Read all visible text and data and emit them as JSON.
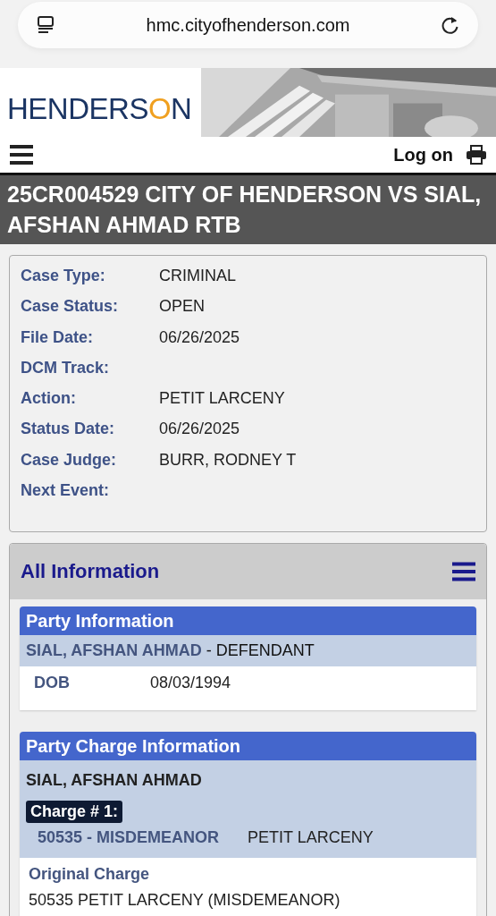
{
  "browser": {
    "url": "hmc.cityofhenderson.com"
  },
  "header": {
    "logo": "HENDERSON"
  },
  "nav": {
    "login": "Log on"
  },
  "case_title": "25CR004529 CITY OF HENDERSON VS SIAL, AFSHAN AHMAD RTB",
  "case_info": [
    {
      "label": "Case Type:",
      "value": "CRIMINAL"
    },
    {
      "label": "Case Status:",
      "value": "OPEN"
    },
    {
      "label": "File Date:",
      "value": "06/26/2025"
    },
    {
      "label": "DCM Track:"
    },
    {
      "label": "Action:",
      "value": "PETIT LARCENY"
    },
    {
      "label": "Status Date:",
      "value": "06/26/2025"
    },
    {
      "label": "Case Judge:",
      "value": "BURR, RODNEY T"
    },
    {
      "label": "Next Event:"
    }
  ],
  "all_information": {
    "title": "All Information",
    "party_information": {
      "title": "Party Information",
      "name": "SIAL, AFSHAN AHMAD",
      "role": "- DEFENDANT",
      "fields": [
        {
          "label": "DOB",
          "value": "08/03/1994"
        }
      ]
    },
    "party_charge_information": {
      "title": "Party Charge Information",
      "name": "SIAL, AFSHAN AHMAD",
      "charges": [
        {
          "label": "Charge # 1:",
          "code": "50535 - MISDEMEANOR",
          "description": "PETIT LARCENY",
          "original_charge_label": "Original Charge",
          "original_charge": "50535 PETIT LARCENY (MISDEMEANOR)"
        }
      ]
    }
  }
}
